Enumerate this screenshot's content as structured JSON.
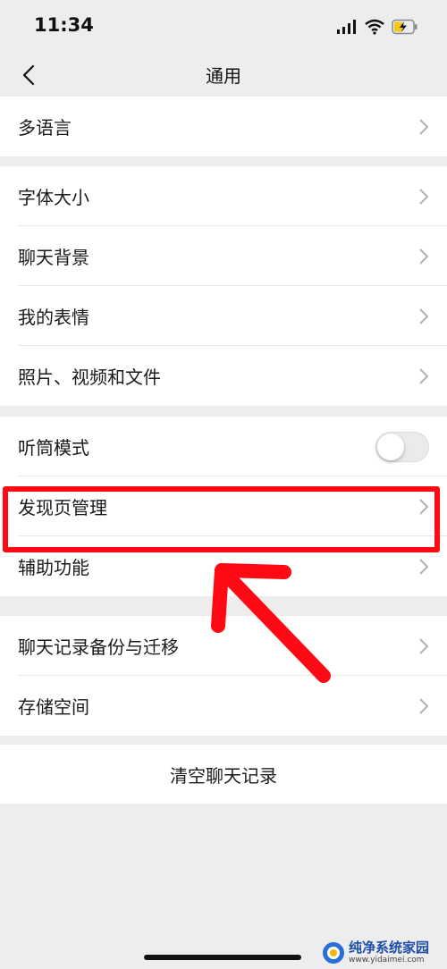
{
  "status_bar": {
    "time": "11:34"
  },
  "header": {
    "title": "通用"
  },
  "groups": [
    {
      "items": [
        {
          "label": "多语言"
        }
      ]
    },
    {
      "items": [
        {
          "label": "字体大小"
        },
        {
          "label": "聊天背景"
        },
        {
          "label": "我的表情"
        },
        {
          "label": "照片、视频和文件"
        }
      ]
    },
    {
      "items": [
        {
          "label": "听筒模式",
          "toggle": false
        },
        {
          "label": "发现页管理"
        },
        {
          "label": "辅助功能"
        }
      ]
    },
    {
      "items": [
        {
          "label": "聊天记录备份与迁移"
        },
        {
          "label": "存储空间"
        }
      ]
    }
  ],
  "clear_chat": {
    "label": "清空聊天记录"
  },
  "watermark": {
    "title": "纯净系统家园",
    "url": "www.yidaimei.com"
  },
  "colors": {
    "highlight": "#ff0a14",
    "battery_charging": "#f5c518"
  }
}
